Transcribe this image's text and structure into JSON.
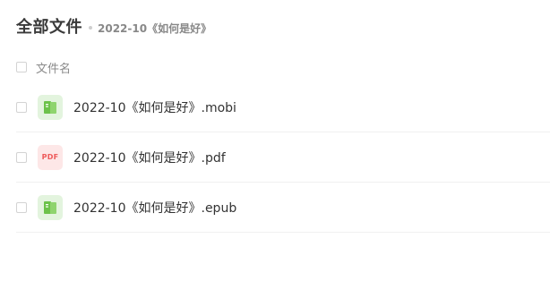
{
  "header": {
    "title": "全部文件",
    "breadcrumb": "2022-10《如何是好》"
  },
  "list": {
    "column_header": "文件名",
    "files": [
      {
        "name": "2022-10《如何是好》.mobi",
        "icon": "ebook-file-icon",
        "icon_color": "#67c23a"
      },
      {
        "name": "2022-10《如何是好》.pdf",
        "icon": "pdf-file-icon",
        "icon_text": "PDF",
        "icon_color": "#ee5a5a"
      },
      {
        "name": "2022-10《如何是好》.epub",
        "icon": "ebook-file-icon",
        "icon_color": "#67c23a"
      }
    ]
  }
}
